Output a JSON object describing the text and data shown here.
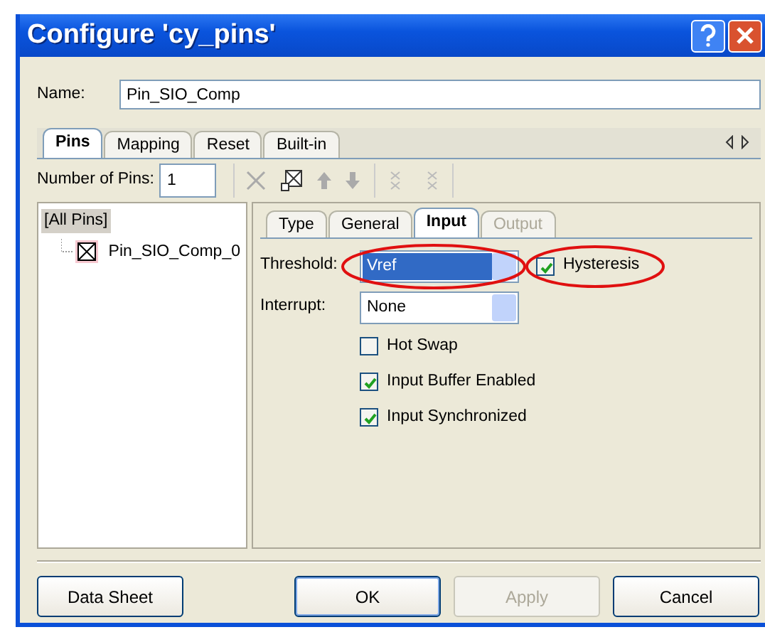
{
  "window": {
    "title": "Configure 'cy_pins'"
  },
  "name_field": {
    "label": "Name:",
    "value": "Pin_SIO_Comp"
  },
  "tabs": [
    {
      "label": "Pins",
      "selected": true
    },
    {
      "label": "Mapping",
      "selected": false
    },
    {
      "label": "Reset",
      "selected": false
    },
    {
      "label": "Built-in",
      "selected": false
    }
  ],
  "pin_count": {
    "label": "Number of Pins:",
    "value": "1"
  },
  "tree": [
    {
      "label": "[All Pins]",
      "selected": true,
      "children": [
        {
          "label": "Pin_SIO_Comp_0",
          "selected": false
        }
      ]
    }
  ],
  "sub_tabs": [
    {
      "label": "Type",
      "selected": false,
      "disabled": false
    },
    {
      "label": "General",
      "selected": false,
      "disabled": false
    },
    {
      "label": "Input",
      "selected": true,
      "disabled": false
    },
    {
      "label": "Output",
      "selected": false,
      "disabled": true
    }
  ],
  "threshold": {
    "label": "Threshold:",
    "value": "Vref",
    "selected": true,
    "circled": true
  },
  "hysteresis": {
    "label": "Hysteresis",
    "checked": true,
    "circled": true
  },
  "interrupt": {
    "label": "Interrupt:",
    "value": "None",
    "selected": false
  },
  "options": [
    {
      "label": "Hot Swap",
      "checked": false
    },
    {
      "label": "Input Buffer Enabled",
      "checked": true
    },
    {
      "label": "Input Synchronized",
      "checked": true
    }
  ],
  "buttons": [
    {
      "label": "Data Sheet",
      "disabled": false,
      "default": false
    },
    {
      "label": "OK",
      "disabled": false,
      "default": true
    },
    {
      "label": "Apply",
      "disabled": true,
      "default": false
    },
    {
      "label": "Cancel",
      "disabled": false,
      "default": false
    }
  ]
}
